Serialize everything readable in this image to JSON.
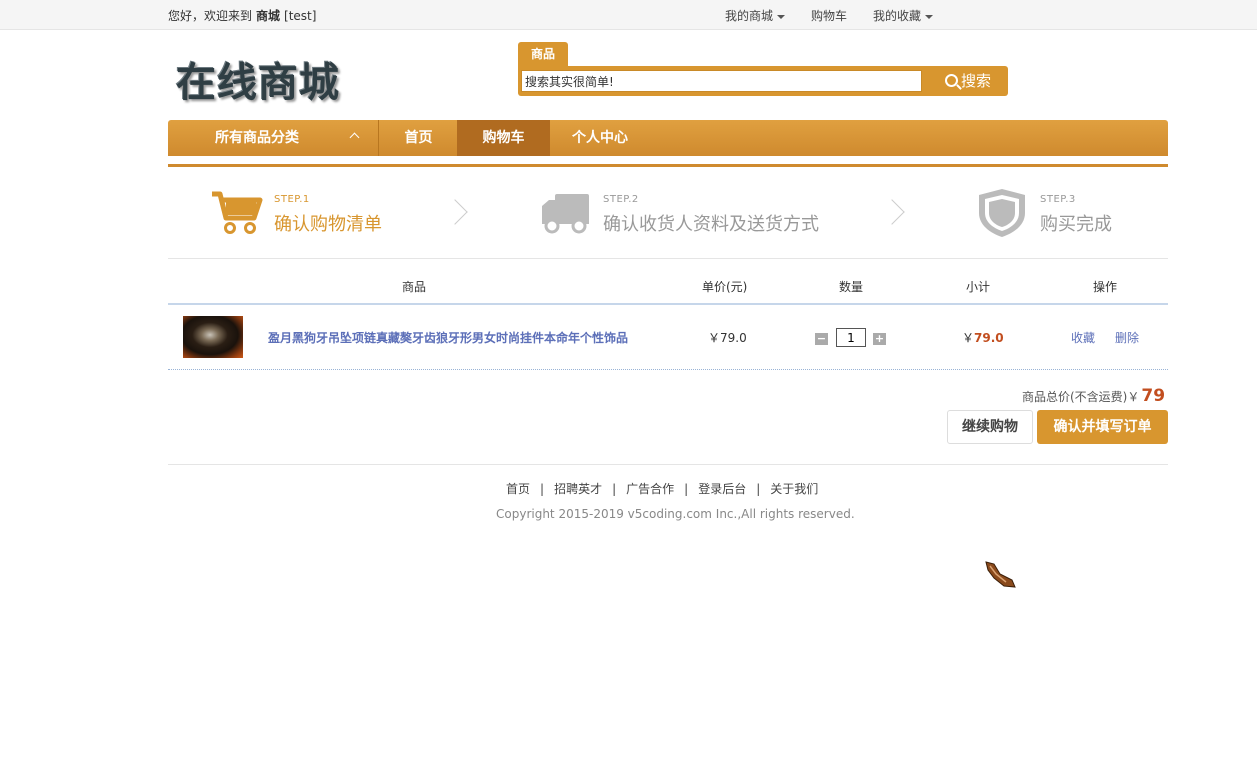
{
  "topbar": {
    "greeting_prefix": "您好，欢迎来到",
    "store_name": "商城",
    "username": "[test]",
    "my_store": "我的商城",
    "cart": "购物车",
    "favorites": "我的收藏"
  },
  "logo": {
    "text": "在线商城"
  },
  "search": {
    "tab_label": "商品",
    "value": "搜索其实很简单!",
    "button_label": "搜索"
  },
  "nav": {
    "categories_label": "所有商品分类",
    "items": [
      {
        "label": "首页"
      },
      {
        "label": "购物车"
      },
      {
        "label": "个人中心"
      }
    ]
  },
  "steps": [
    {
      "small": "STEP.1",
      "label": "确认购物清单",
      "icon": "cart-icon"
    },
    {
      "small": "STEP.2",
      "label": "确认收货人资料及送货方式",
      "icon": "truck-icon"
    },
    {
      "small": "STEP.3",
      "label": "购买完成",
      "icon": "shield-icon"
    }
  ],
  "table": {
    "headers": {
      "product": "商品",
      "unit_price": "单价(元)",
      "quantity": "数量",
      "subtotal": "小计",
      "actions": "操作"
    },
    "rows": [
      {
        "name": "盈月黑狗牙吊坠项链真藏獒牙齿狼牙形男女时尚挂件本命年个性饰品",
        "price": "￥79.0",
        "quantity": "1",
        "subtotal_symbol": "￥",
        "subtotal_value": "79.0",
        "favorite": "收藏",
        "delete": "删除"
      }
    ]
  },
  "summary": {
    "total_label": "商品总价(不含运费)￥",
    "total_value": "79",
    "continue_label": "继续购物",
    "confirm_label": "确认并填写订单"
  },
  "footer": {
    "links": [
      "首页",
      "招聘英才",
      "广告合作",
      "登录后台",
      "关于我们"
    ],
    "separator": "|",
    "copyright": "Copyright 2015-2019 v5coding.com Inc.,All rights reserved."
  },
  "colors": {
    "accent": "#d8962f",
    "nav_active": "#b06b20",
    "price_red": "#c24e1f",
    "link_blue": "#5c6fb8"
  }
}
